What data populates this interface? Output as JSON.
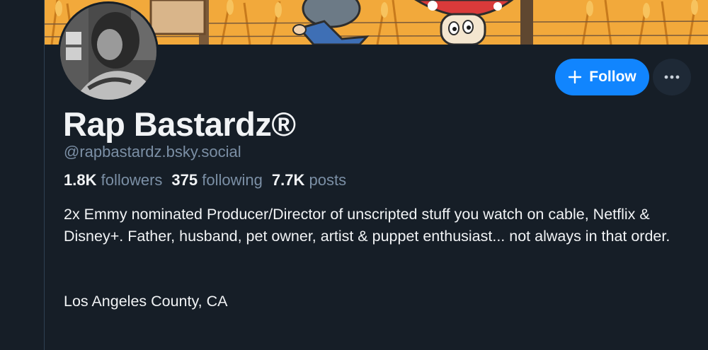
{
  "profile": {
    "display_name": "Rap Bastardz®",
    "handle": "@rapbastardz.bsky.social",
    "bio_text": "2x Emmy nominated Producer/Director of unscripted stuff you watch on cable, Netflix & Disney+. Father, husband, pet owner, artist & puppet enthusiast... not always in that order.",
    "location": "Los Angeles County, CA"
  },
  "stats": {
    "followers_count": "1.8K",
    "followers_label": "followers",
    "following_count": "375",
    "following_label": "following",
    "posts_count": "7.7K",
    "posts_label": "posts"
  },
  "actions": {
    "follow_label": "Follow",
    "follow_icon": "plus-icon",
    "more_icon": "ellipsis-icon"
  },
  "colors": {
    "background": "#161e27",
    "accent": "#1185fe",
    "muted_text": "#7b8fa5",
    "more_button_bg": "#1e2936"
  }
}
